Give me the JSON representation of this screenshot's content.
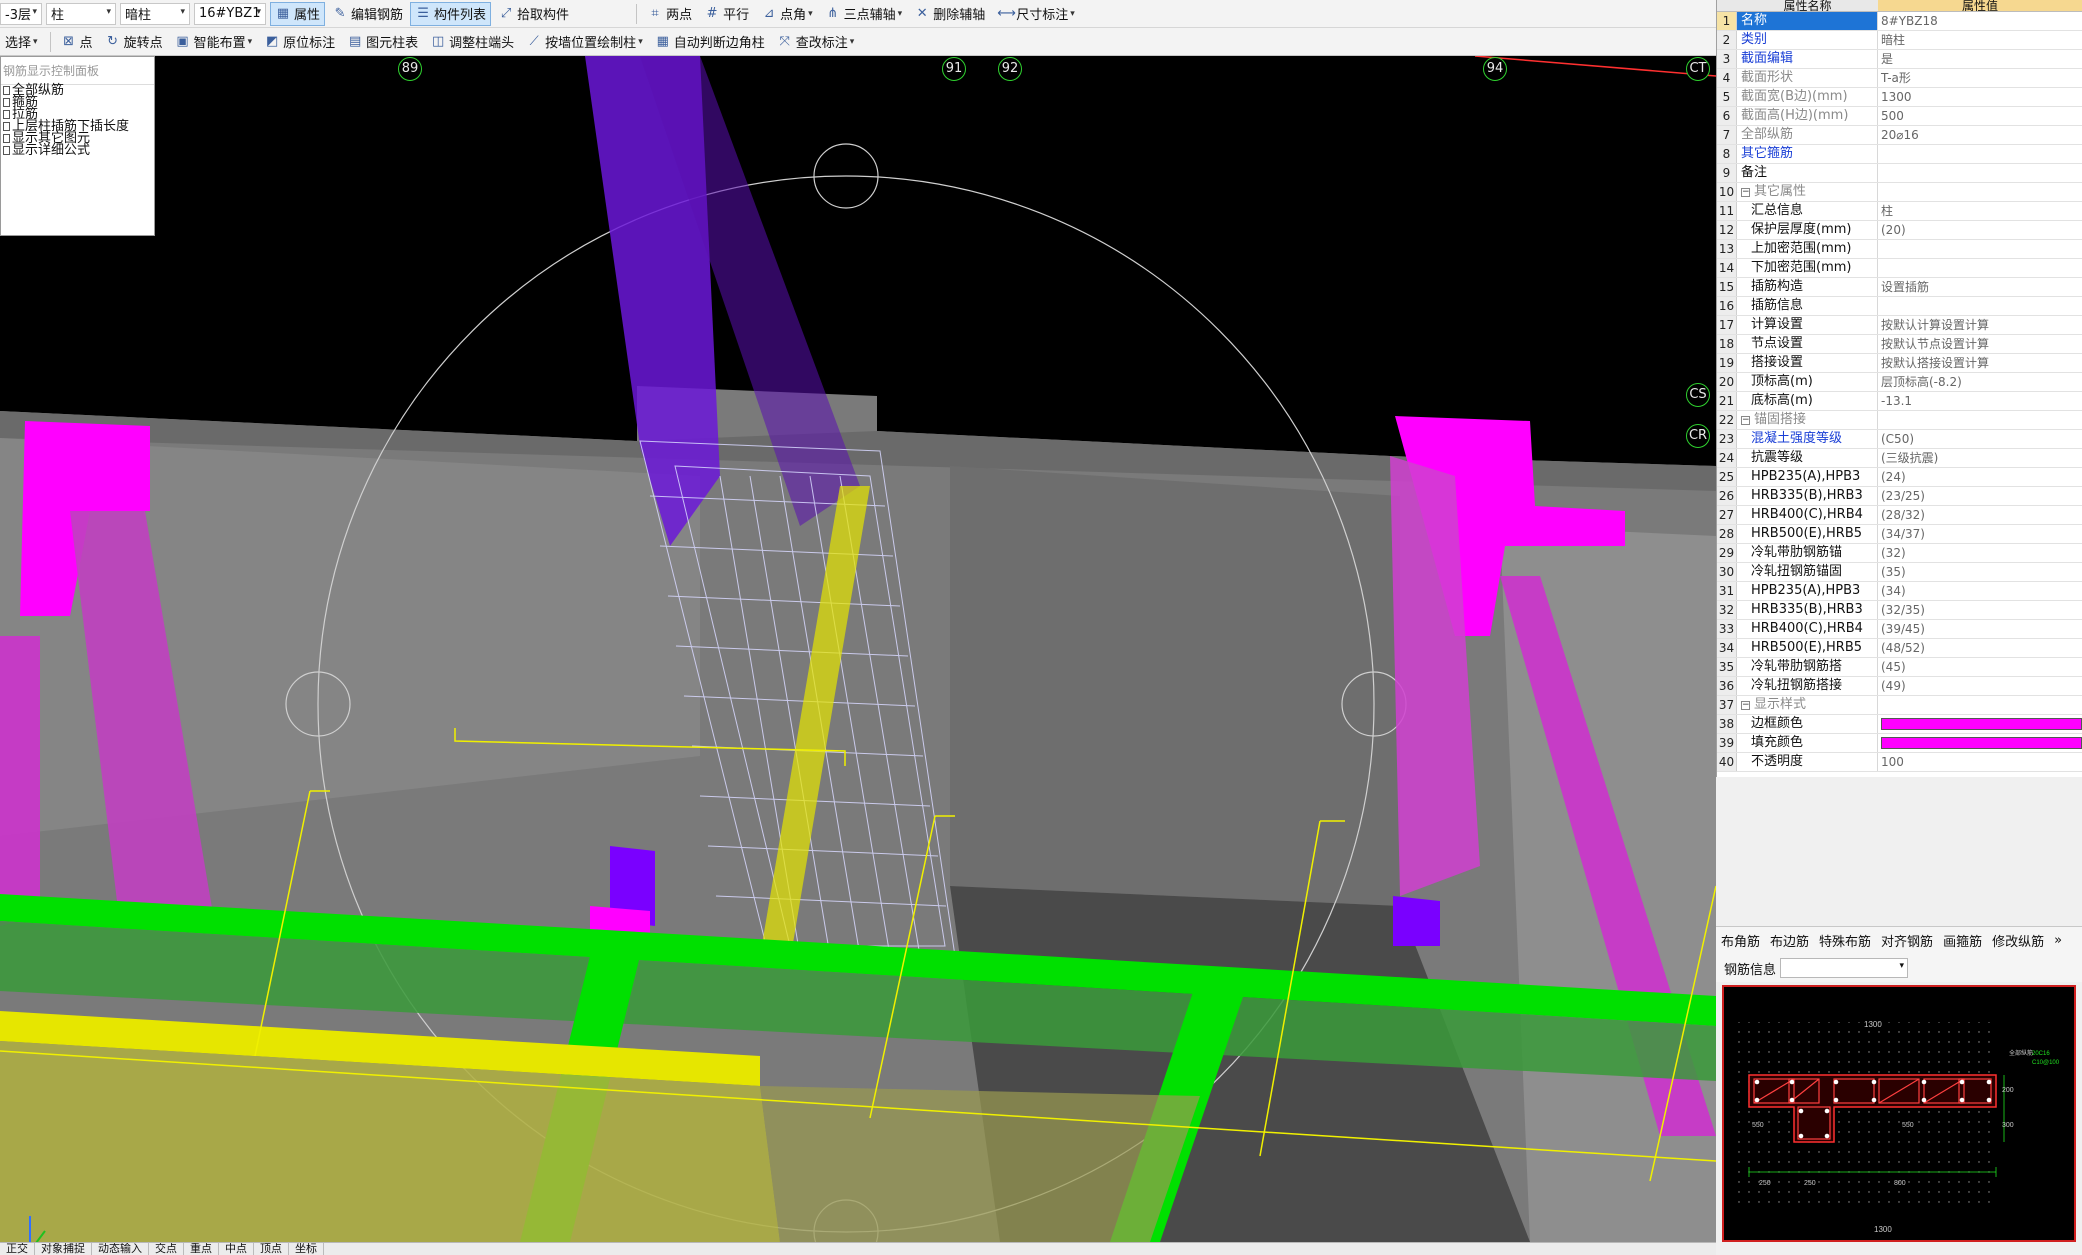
{
  "toolbar1": {
    "floor": "-3层",
    "category": "柱",
    "type": "暗柱",
    "component": "16#YBZ1",
    "buttons": [
      {
        "label": "属性",
        "icon": "property-icon",
        "active": true
      },
      {
        "label": "编辑钢筋",
        "icon": "edit-rebar-icon",
        "active": false
      },
      {
        "label": "构件列表",
        "icon": "component-list-icon",
        "active": true
      },
      {
        "label": "拾取构件",
        "icon": "pick-icon",
        "active": false
      }
    ],
    "draw_buttons": [
      {
        "label": "两点",
        "icon": "two-point-icon"
      },
      {
        "label": "平行",
        "icon": "parallel-icon"
      },
      {
        "label": "点角",
        "icon": "point-angle-icon"
      },
      {
        "label": "三点辅轴",
        "icon": "three-point-axis-icon"
      },
      {
        "label": "删除辅轴",
        "icon": "delete-axis-icon"
      },
      {
        "label": "尺寸标注",
        "icon": "dimension-icon"
      }
    ]
  },
  "toolbar2": {
    "buttons": [
      {
        "label": "选择",
        "icon": "select-icon"
      },
      {
        "label": "点",
        "icon": "point-icon"
      },
      {
        "label": "旋转点",
        "icon": "rotate-point-icon"
      },
      {
        "label": "智能布置",
        "icon": "smart-place-icon"
      },
      {
        "label": "原位标注",
        "icon": "in-place-label-icon"
      },
      {
        "label": "图元柱表",
        "icon": "column-table-icon"
      },
      {
        "label": "调整柱端头",
        "icon": "adjust-column-end-icon"
      },
      {
        "label": "按墙位置绘制柱",
        "icon": "wall-column-icon"
      },
      {
        "label": "自动判断边角柱",
        "icon": "auto-corner-icon"
      },
      {
        "label": "查改标注",
        "icon": "check-label-icon"
      }
    ]
  },
  "axes": [
    "89",
    "91",
    "92",
    "94",
    "CT",
    "CS",
    "CR"
  ],
  "rebar_panel": {
    "title": "钢筋显示控制面板",
    "items": [
      "全部纵筋",
      "箍筋",
      "拉筋",
      "上层柱插筋下插长度",
      "显示其它图元",
      "显示详细公式"
    ]
  },
  "properties": {
    "header_name": "属性名称",
    "header_value": "属性值",
    "rows": [
      {
        "n": "1",
        "name": "名称",
        "value": "8#YBZ18",
        "style": "sel"
      },
      {
        "n": "2",
        "name": "类别",
        "value": "暗柱",
        "style": "blue"
      },
      {
        "n": "3",
        "name": "截面编辑",
        "value": "是",
        "style": "blue"
      },
      {
        "n": "4",
        "name": "截面形状",
        "value": "T-a形",
        "style": "grey"
      },
      {
        "n": "5",
        "name": "截面宽(B边)(mm)",
        "value": "1300",
        "style": "grey"
      },
      {
        "n": "6",
        "name": "截面高(H边)(mm)",
        "value": "500",
        "style": "grey"
      },
      {
        "n": "7",
        "name": "全部纵筋",
        "value": "20⌀16",
        "style": "grey"
      },
      {
        "n": "8",
        "name": "其它箍筋",
        "value": "",
        "style": "blue"
      },
      {
        "n": "9",
        "name": "备注",
        "value": "",
        "style": "dark"
      },
      {
        "n": "10",
        "name": "其它属性",
        "value": "",
        "style": "group"
      },
      {
        "n": "11",
        "name": "汇总信息",
        "value": "柱",
        "style": "ind"
      },
      {
        "n": "12",
        "name": "保护层厚度(mm)",
        "value": "(20)",
        "style": "ind"
      },
      {
        "n": "13",
        "name": "上加密范围(mm)",
        "value": "",
        "style": "ind"
      },
      {
        "n": "14",
        "name": "下加密范围(mm)",
        "value": "",
        "style": "ind"
      },
      {
        "n": "15",
        "name": "插筋构造",
        "value": "设置插筋",
        "style": "ind"
      },
      {
        "n": "16",
        "name": "插筋信息",
        "value": "",
        "style": "ind"
      },
      {
        "n": "17",
        "name": "计算设置",
        "value": "按默认计算设置计算",
        "style": "ind"
      },
      {
        "n": "18",
        "name": "节点设置",
        "value": "按默认节点设置计算",
        "style": "ind"
      },
      {
        "n": "19",
        "name": "搭接设置",
        "value": "按默认搭接设置计算",
        "style": "ind"
      },
      {
        "n": "20",
        "name": "顶标高(m)",
        "value": "层顶标高(-8.2)",
        "style": "ind"
      },
      {
        "n": "21",
        "name": "底标高(m)",
        "value": "-13.1",
        "style": "ind"
      },
      {
        "n": "22",
        "name": "锚固搭接",
        "value": "",
        "style": "group"
      },
      {
        "n": "23",
        "name": "混凝土强度等级",
        "value": "(C50)",
        "style": "indblue"
      },
      {
        "n": "24",
        "name": "抗震等级",
        "value": "(三级抗震)",
        "style": "ind"
      },
      {
        "n": "25",
        "name": "HPB235(A),HPB3",
        "value": "(24)",
        "style": "ind"
      },
      {
        "n": "26",
        "name": "HRB335(B),HRB3",
        "value": "(23/25)",
        "style": "ind"
      },
      {
        "n": "27",
        "name": "HRB400(C),HRB4",
        "value": "(28/32)",
        "style": "ind"
      },
      {
        "n": "28",
        "name": "HRB500(E),HRB5",
        "value": "(34/37)",
        "style": "ind"
      },
      {
        "n": "29",
        "name": "冷轧带肋钢筋锚",
        "value": "(32)",
        "style": "ind"
      },
      {
        "n": "30",
        "name": "冷轧扭钢筋锚固",
        "value": "(35)",
        "style": "ind"
      },
      {
        "n": "31",
        "name": "HPB235(A),HPB3",
        "value": "(34)",
        "style": "ind"
      },
      {
        "n": "32",
        "name": "HRB335(B),HRB3",
        "value": "(32/35)",
        "style": "ind"
      },
      {
        "n": "33",
        "name": "HRB400(C),HRB4",
        "value": "(39/45)",
        "style": "ind"
      },
      {
        "n": "34",
        "name": "HRB500(E),HRB5",
        "value": "(48/52)",
        "style": "ind"
      },
      {
        "n": "35",
        "name": "冷轧带肋钢筋搭",
        "value": "(45)",
        "style": "ind"
      },
      {
        "n": "36",
        "name": "冷轧扭钢筋搭接",
        "value": "(49)",
        "style": "ind"
      },
      {
        "n": "37",
        "name": "显示样式",
        "value": "",
        "style": "group"
      },
      {
        "n": "38",
        "name": "边框颜色",
        "value": "",
        "style": "indswatch"
      },
      {
        "n": "39",
        "name": "填充颜色",
        "value": "",
        "style": "indswatch"
      },
      {
        "n": "40",
        "name": "不透明度",
        "value": "100",
        "style": "ind"
      }
    ]
  },
  "rebar_tools": [
    "布角筋",
    "布边筋",
    "特殊布筋",
    "对齐钢筋",
    "画箍筋",
    "修改纵筋"
  ],
  "rebar_info_label": "钢筋信息",
  "section_labels": {
    "top_dim": "1300",
    "right_dim": "200",
    "right_dim2": "300",
    "bottom_dim1": "250",
    "bottom_dim2": "250",
    "bottom_dim3": "800",
    "left_dim": "550",
    "mid_dim": "550",
    "note1": "全部纵筋",
    "note2": "20C16",
    "note3": "C10@100"
  },
  "statusbar": [
    "正交",
    "对象捕捉",
    "动态输入",
    "交点",
    "重点",
    "中点",
    "顶点",
    "坐标"
  ],
  "colors": {
    "viewport_bg": "#000000",
    "column_magenta": "#ff00ff",
    "beam_green": "#00e000",
    "highlight_yellow": "#e6e600",
    "selected_purple": "#7b00ff",
    "wall_grey": "#7d7d7d"
  }
}
